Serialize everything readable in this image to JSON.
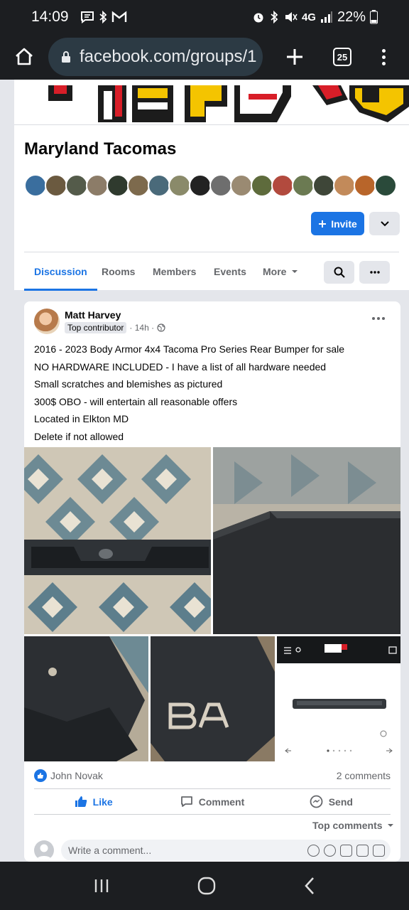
{
  "status_bar": {
    "time": "14:09",
    "network": "4G",
    "battery": "22%"
  },
  "browser": {
    "url": "facebook.com/groups/1",
    "tab_count": "25"
  },
  "group": {
    "name": "Maryland Tacomas",
    "invite_label": "Invite",
    "tabs": [
      {
        "label": "Discussion"
      },
      {
        "label": "Rooms"
      },
      {
        "label": "Members"
      },
      {
        "label": "Events"
      },
      {
        "label": "More"
      }
    ]
  },
  "post": {
    "author": "Matt Harvey",
    "badge": "Top contributor",
    "time": "· 14h ·",
    "lines": [
      "2016 - 2023 Body Armor 4x4 Tacoma Pro Series Rear Bumper for sale",
      "NO HARDWARE INCLUDED - I have a list of all hardware needed",
      "Small scratches and blemishes as pictured",
      "300$ OBO - will entertain all reasonable offers",
      "Located in Elkton MD",
      "Delete if not allowed"
    ],
    "reactor": "John Novak",
    "comments_count": "2 comments",
    "actions": {
      "like": "Like",
      "comment": "Comment",
      "send": "Send"
    },
    "top_comments": "Top comments",
    "comment_placeholder": "Write a comment..."
  },
  "colors": {
    "brand_blue": "#1b74e4",
    "background": "#e4e6eb"
  }
}
